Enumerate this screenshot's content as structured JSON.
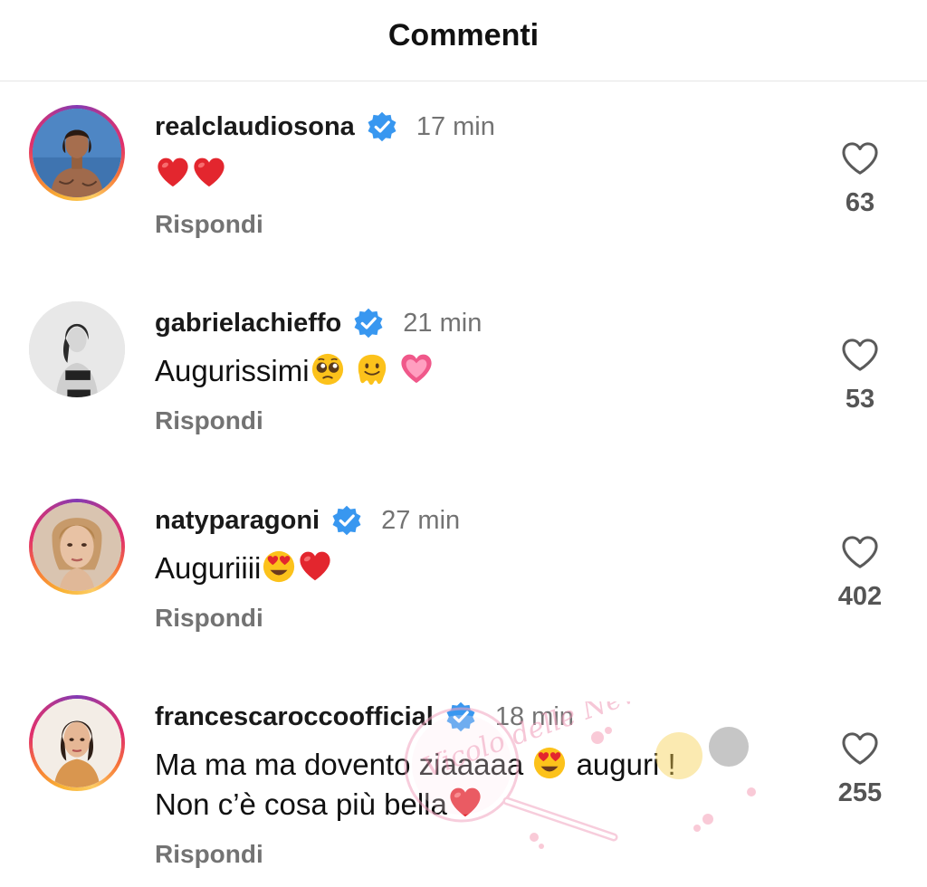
{
  "header": {
    "title": "Commenti"
  },
  "comments": [
    {
      "username": "realclaudiosona",
      "time": "17 min",
      "text": "",
      "emojis": [
        "red-heart-emoji",
        "red-heart-emoji"
      ],
      "reply_label": "Rispondi",
      "likes": "63",
      "avatar": "man-shirtless-avatar"
    },
    {
      "username": "gabrielachieffo",
      "time": "21 min",
      "text": "Augurissimi",
      "emojis": [
        "pleading-face-emoji",
        "melting-face-emoji",
        "pink-heart-emoji"
      ],
      "reply_label": "Rispondi",
      "likes": "53",
      "avatar": "woman-bw-avatar"
    },
    {
      "username": "natyparagoni",
      "time": "27 min",
      "text": "Auguriiii",
      "emojis": [
        "heart-eyes-emoji",
        "red-heart-emoji"
      ],
      "reply_label": "Rispondi",
      "likes": "402",
      "avatar": "woman-blonde-avatar"
    },
    {
      "username": "francescaroccoofficial",
      "time": "18 min",
      "text_line1": "Ma ma ma dovento ziaaaaa",
      "text_line1b": "auguri !",
      "text_line2": "Non c’è cosa più bella",
      "emojis": [
        "heart-eyes-emoji",
        "red-heart-emoji"
      ],
      "reply_label": "Rispondi",
      "likes": "255",
      "avatar": "woman-brunette-avatar"
    }
  ],
  "watermark": {
    "text": "Vicolo delle News"
  },
  "colors": {
    "verified_blue": "#3897f0",
    "muted_text": "#737373",
    "heart_red": "#e3262e",
    "pink_heart": "#f0588a"
  }
}
